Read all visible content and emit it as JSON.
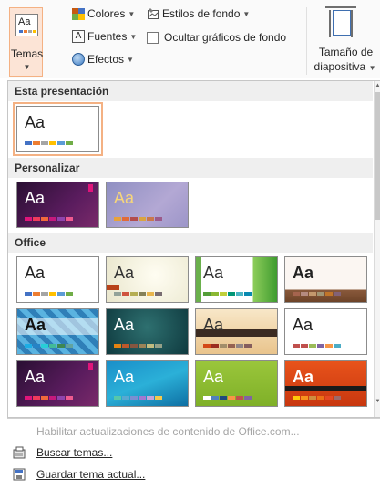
{
  "ribbon": {
    "temas": {
      "label": "Temas",
      "icon": "themes-aa-icon",
      "icon_text": "Aa"
    },
    "colores": {
      "label": "Colores",
      "icon": "colors-icon"
    },
    "fuentes": {
      "label": "Fuentes",
      "icon": "fonts-icon",
      "icon_text": "A"
    },
    "efectos": {
      "label": "Efectos",
      "icon": "effects-icon"
    },
    "estilos_fondo": {
      "label": "Estilos de fondo",
      "icon": "background-styles-icon"
    },
    "ocultar_graficos": {
      "label": "Ocultar gráficos de fondo",
      "checked": false
    },
    "tamano": {
      "line1": "Tamaño de",
      "line2": "diapositiva"
    }
  },
  "sections": [
    {
      "title": "Esta presentación"
    },
    {
      "title": "Personalizar"
    },
    {
      "title": "Office"
    }
  ],
  "themes": {
    "current": {
      "text": "Aa",
      "selected": true
    },
    "custom": [
      {
        "text": "Aa"
      },
      {
        "text": "Aa"
      }
    ],
    "office": [
      {
        "text": "Aa"
      },
      {
        "text": "Aa"
      },
      {
        "text": "Aa"
      },
      {
        "text": "Aa"
      },
      {
        "text": "Aa"
      },
      {
        "text": "Aa"
      },
      {
        "text": "Aa"
      },
      {
        "text": "Aa"
      },
      {
        "text": "Aa"
      },
      {
        "text": "Aa"
      },
      {
        "text": "Aa"
      },
      {
        "text": "Aa"
      }
    ]
  },
  "menu": {
    "habilitar": "Habilitar actualizaciones de contenido de Office.com...",
    "buscar": "Buscar temas...",
    "guardar": "Guardar tema actual..."
  },
  "colors": {
    "accent": "#f4b183",
    "accent_fill": "#fce4d6",
    "header_bg": "#efefef",
    "disabled_text": "#a6a6a6"
  }
}
